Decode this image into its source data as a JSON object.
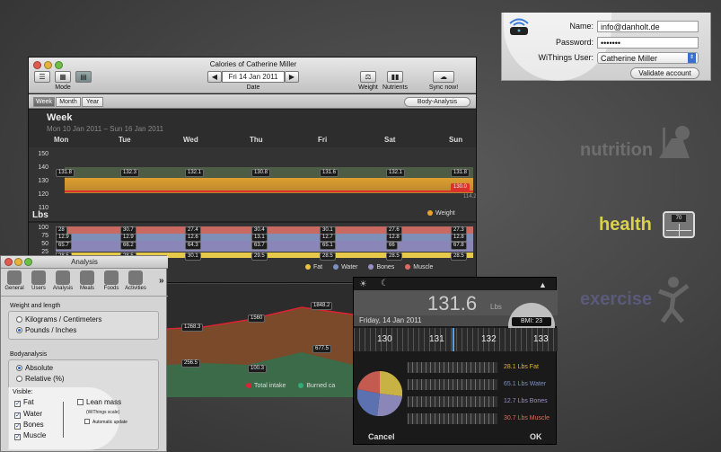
{
  "login": {
    "name_label": "Name:",
    "name_value": "info@danholt.de",
    "password_label": "Password:",
    "password_value": "•••••••",
    "user_label": "WiThings User:",
    "user_value": "Catherine Miller",
    "validate": "Validate account"
  },
  "side": {
    "nutrition": "nutrition",
    "health": "health",
    "exercise": "exercise",
    "scale_reading": "70"
  },
  "main": {
    "title": "Calories of Catherine Miller",
    "mode_label": "Mode",
    "date_label": "Date",
    "date_value": "Fri 14 Jan 2011",
    "weight": "Weight",
    "nutrients": "Nutrients",
    "sync": "Sync now!",
    "tab_week": "Week",
    "tab_month": "Month",
    "tab_year": "Year",
    "body_analysis": "Body-Analysis",
    "period": "Week",
    "range": "Mon 10 Jan 2011 – Sun 16 Jan 2011",
    "days": [
      "Mon",
      "Tue",
      "Wed",
      "Thu",
      "Fri",
      "Sat",
      "Sun"
    ],
    "y_weight": [
      "150",
      "140",
      "130",
      "120",
      "110"
    ],
    "y_unit": "Lbs",
    "weight_vals": [
      "131.8",
      "132.3",
      "132.1",
      "130.8",
      "131.6",
      "132.1",
      "131.8"
    ],
    "target": "130.0",
    "target2": "114.2",
    "y_body": [
      "100",
      "75",
      "50",
      "25"
    ],
    "fat_vals": [
      "28",
      "30.7",
      "27.4",
      "30.4",
      "30.1",
      "27.6",
      "27.3"
    ],
    "water_vals": [
      "12.9",
      "12.9",
      "12.6",
      "13.1",
      "12.7",
      "12.8",
      "12.8"
    ],
    "bones_vals": [
      "65.7",
      "66.2",
      "64.3",
      "63.7",
      "65.1",
      "66",
      "67.8"
    ],
    "muscle_vals": [
      "28.5",
      "28.5",
      "30.1",
      "29.5",
      "28.5",
      "28.5",
      "28.5"
    ],
    "legend_weight": "Weight",
    "legend_fat": "Fat",
    "legend_water": "Water",
    "legend_bones": "Bones",
    "legend_muscle": "Muscle",
    "cal_vals": [
      "1268.3",
      "1560",
      "1848.2",
      "677.5",
      "256.5",
      "100.3"
    ],
    "legend_total": "Total intake",
    "legend_burned": "Burned ca"
  },
  "analysis": {
    "title": "Analysis",
    "prefs": [
      "General",
      "Users",
      "Analysis",
      "Meals",
      "Foods",
      "Activities"
    ],
    "wl_heading": "Weight and length",
    "kg": "Kilograms / Centimeters",
    "lbs": "Pounds / Inches",
    "ba_heading": "Bodyanalysis",
    "absolute": "Absolute",
    "relative": "Relative (%)",
    "visible": "Visible:",
    "fat": "Fat",
    "water": "Water",
    "bones": "Bones",
    "muscle": "Muscle",
    "lean": "Lean mass",
    "withings_scale": "(WiThings scale)",
    "auto": "Automatic update"
  },
  "bmi": {
    "weight": "131.6",
    "unit": "Lbs",
    "date": "Friday, 14 Jan 2011",
    "bmi": "BMI: 23",
    "scale": [
      "130",
      "131",
      "132",
      "133"
    ],
    "fat": "28.1 Lbs Fat",
    "water": "65.1 Lbs Water",
    "bones": "12.7 Lbs Bones",
    "muscle": "30.7 Lbs Muscle",
    "cancel": "Cancel",
    "ok": "OK"
  },
  "colors": {
    "fat": "#e06a5e",
    "water": "#7c90c4",
    "bones": "#9b8ec8",
    "muscle": "#e8c340",
    "weight": "#e8a030",
    "health": "#d9d24a"
  }
}
